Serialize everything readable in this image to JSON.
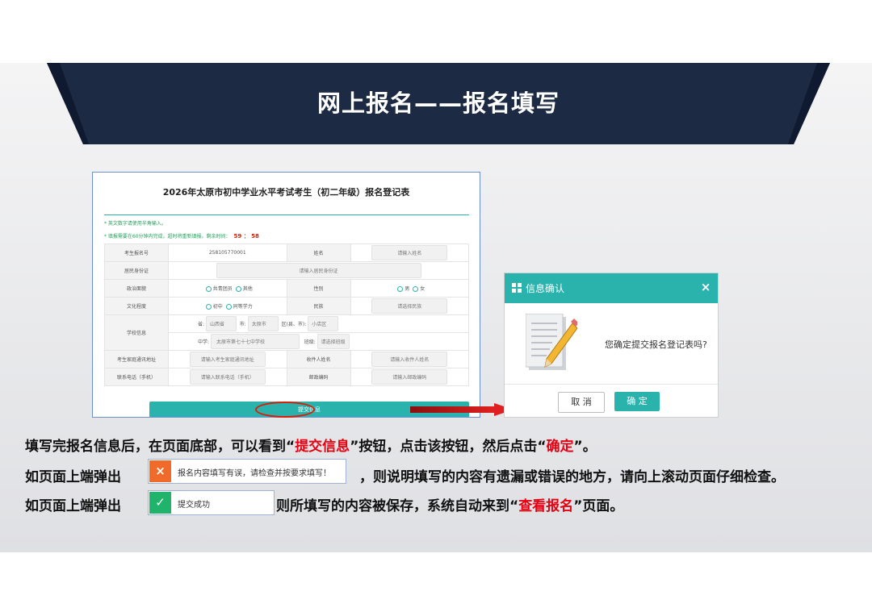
{
  "banner": {
    "title": "网上报名——报名填写"
  },
  "form": {
    "title": "2026年太原市初中学业水平考试考生（初二年级）报名登记表",
    "note1": "* 英文数字请使用半角输入。",
    "note2": "* 填报需要在60分钟内完成，超时将重新填报。剩余时间：",
    "timer": "59 ： 58",
    "rows": {
      "exam_no_label": "考生报名号",
      "exam_no_value": "258105770001",
      "name_label": "姓名",
      "name_placeholder": "请输入姓名",
      "id_label": "居民身份证",
      "id_placeholder": "请输入居民身份证",
      "politics_label": "政治面貌",
      "politics_opt1": "共青团员",
      "politics_opt2": "其他",
      "gender_label": "性别",
      "gender_opt1": "男",
      "gender_opt2": "女",
      "edu_label": "文化程度",
      "edu_opt1": "初中",
      "edu_opt2": "同等学力",
      "ethnic_label": "民族",
      "ethnic_placeholder": "请选择民族",
      "school_label": "学校信息",
      "province_label": "省:",
      "province_value": "山西省",
      "city_label": "市:",
      "city_value": "太原市",
      "district_label": "区(县、市):",
      "district_value": "小店区",
      "middle_label": "中学:",
      "middle_value": "太原市第七十七中学校",
      "class_label": "班级:",
      "class_placeholder": "请选择班级",
      "addr_label": "考生家庭通讯地址",
      "addr_placeholder": "请输入考生家庭通讯地址",
      "recipient_label": "收件人姓名",
      "recipient_placeholder": "请输入收件人姓名",
      "phone_label": "联系电话（手机）",
      "phone_placeholder": "请输入联系电话（手机）",
      "zip_label": "邮政编码",
      "zip_placeholder": "请输入邮政编码"
    },
    "submit_label": "提交信息"
  },
  "dialog": {
    "title": "信息确认",
    "message": "您确定提交报名登记表吗?",
    "cancel_label": "取 消",
    "ok_label": "确 定",
    "close_icon": "×"
  },
  "instructions": {
    "l1_a": "填写完报名信息后，在页面底部，可以看到“",
    "l1_b": "提交信息",
    "l1_c": "”按钮，点击该按钮，然后点击“",
    "l1_d": "确定",
    "l1_e": "”。",
    "l2_a": "如页面上端弹出",
    "l2_b": "，则说明填写的内容有遗漏或错误的地方，请向上滚动页面仔细检查。",
    "l3_a": "如页面上端弹出",
    "l3_b": "则所填写的内容被保存，系统自动来到“",
    "l3_c": "查看报名",
    "l3_d": "”页面。"
  },
  "toasts": {
    "error_text": "报名内容填写有误，请检查并按要求填写！",
    "error_icon": "×",
    "success_text": "提交成功",
    "success_icon": "✓"
  },
  "colors": {
    "banner": "#1d2a44",
    "accent": "#2ab3ad",
    "highlight": "#e60012",
    "error": "#f06a2a",
    "success": "#1fb36b"
  }
}
